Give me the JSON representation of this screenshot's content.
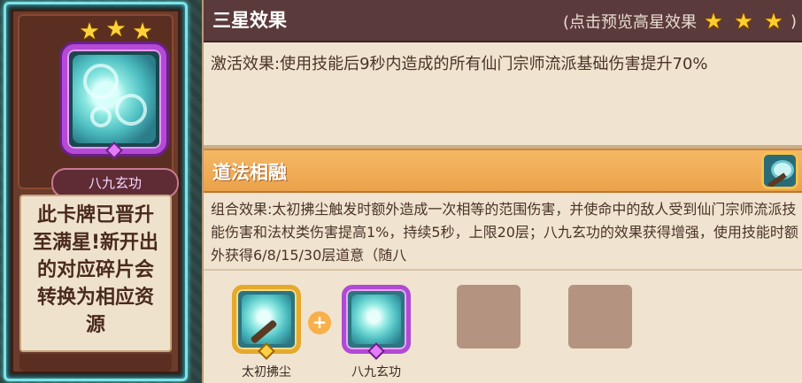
{
  "card": {
    "star_count": 3,
    "name": "八九玄功",
    "message": "此卡牌已晋升至满星!新开出的对应碎片会转换为相应资源"
  },
  "header": {
    "title": "三星效果",
    "preview_label": "(点击预览高星效果",
    "preview_close": ")"
  },
  "activation": {
    "text": "激活效果:使用技能后9秒内造成的所有仙门宗师流派基础伤害提升70%"
  },
  "combo": {
    "title": "道法相融",
    "text": "组合效果:太初拂尘触发时额外造成一次相等的范围伤害，并使命中的敌人受到仙门宗师流派技能伤害和法杖类伤害提高1%，持续5秒，上限20层；八九玄功的效果获得增强，使用技能时额外获得6/8/15/30层道意（随八"
  },
  "items": [
    {
      "label": "太初拂尘",
      "frame": "gold"
    },
    {
      "label": "八九玄功",
      "frame": "purple"
    },
    {
      "label": "",
      "frame": "empty"
    },
    {
      "label": "",
      "frame": "empty"
    }
  ],
  "plus_symbol": "+",
  "icons": {
    "star": "star-icon",
    "combo": "whisk-icon"
  },
  "colors": {
    "header_bg": "#5b3a3c",
    "section_bg": "#eaa24a",
    "panel_bg": "#f0e3cf",
    "card_border": "#7de3e8"
  }
}
